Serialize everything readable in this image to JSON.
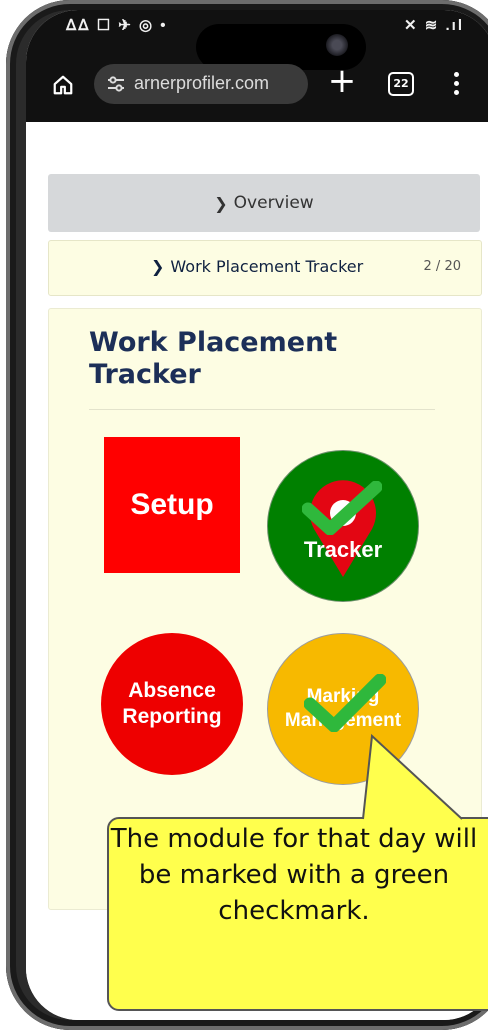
{
  "status_bar": {
    "left_glyphs": "ᐃᐃ ☐ ✈ ◎ •",
    "right_glyphs": "✕ ≋ .ıl"
  },
  "browser": {
    "url": "arnerprofiler.com",
    "tab_count": "22",
    "new_tab_label": "+"
  },
  "page": {
    "overview_label": "Overview",
    "section_label": "Work Placement Tracker",
    "section_count": "2 / 20",
    "card_title": "Work Placement Tracker",
    "tiles": {
      "setup": "Setup",
      "tracker": "Tracker",
      "absence": "Absence Reporting",
      "marking": "Marking Management"
    }
  },
  "callout": {
    "text": "The module for that day will be marked with a green checkmark."
  },
  "colors": {
    "setup": "#ff0000",
    "tracker": "#008000",
    "absence": "#ee0000",
    "marking": "#f7b900",
    "check": "#2fb83c",
    "callout": "#ffff4d"
  },
  "icons": [
    "home-icon",
    "tune-icon",
    "tabs-icon",
    "more-vert-icon",
    "location-pin-icon",
    "checkmark-icon",
    "chevron-right-icon"
  ]
}
